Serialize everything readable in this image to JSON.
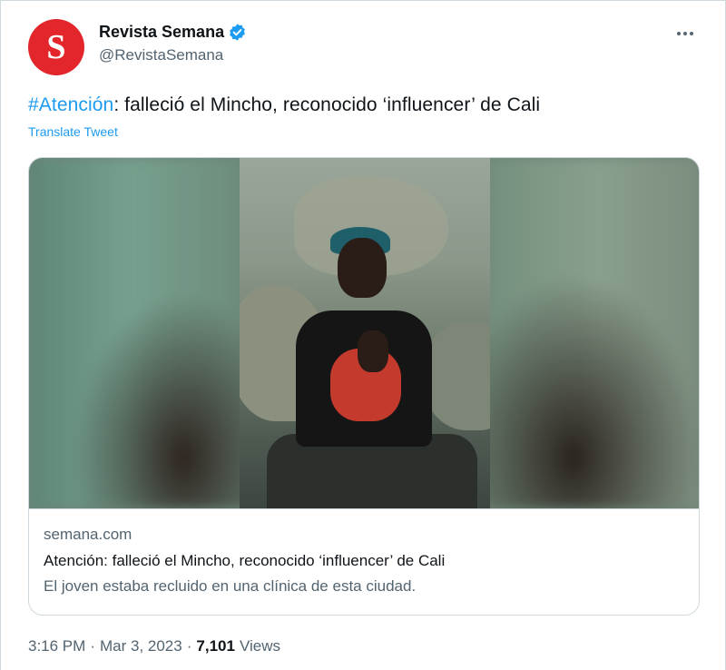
{
  "author": {
    "avatar_letter": "S",
    "avatar_color": "#e3262b",
    "display_name": "Revista Semana",
    "verified_icon": "verified-badge-icon",
    "handle": "@RevistaSemana"
  },
  "more_icon": "more-options-icon",
  "tweet": {
    "hashtag": "#Atención",
    "text": ": falleció el Mincho, reconocido ‘influencer’ de Cali",
    "translate_label": "Translate Tweet"
  },
  "card": {
    "domain": "semana.com",
    "title": "Atención: falleció el Mincho, reconocido ‘influencer’ de Cali",
    "description": "El joven estaba recluido en una clínica de esta ciudad."
  },
  "meta": {
    "time": "3:16 PM",
    "separator1": "·",
    "date": "Mar 3, 2023",
    "separator2": "·",
    "views_count": "7,101",
    "views_label": "Views"
  },
  "colors": {
    "link": "#1d9bf0",
    "secondary_text": "#536471",
    "primary_text": "#0f1419",
    "border": "#cfd9de"
  }
}
